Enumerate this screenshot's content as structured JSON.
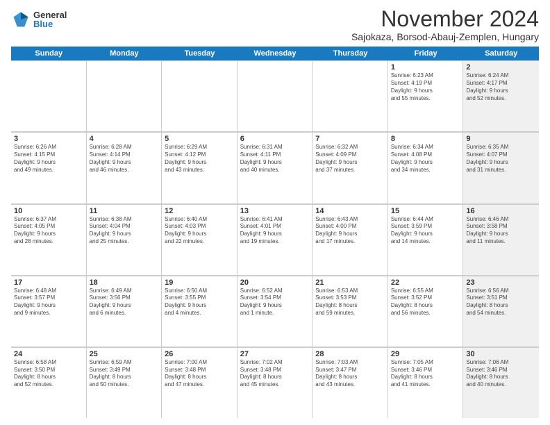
{
  "logo": {
    "general": "General",
    "blue": "Blue"
  },
  "title": "November 2024",
  "subtitle": "Sajokaza, Borsod-Abauj-Zemplen, Hungary",
  "header_days": [
    "Sunday",
    "Monday",
    "Tuesday",
    "Wednesday",
    "Thursday",
    "Friday",
    "Saturday"
  ],
  "rows": [
    [
      {
        "day": "",
        "info": "",
        "shaded": false,
        "empty": true
      },
      {
        "day": "",
        "info": "",
        "shaded": false,
        "empty": true
      },
      {
        "day": "",
        "info": "",
        "shaded": false,
        "empty": true
      },
      {
        "day": "",
        "info": "",
        "shaded": false,
        "empty": true
      },
      {
        "day": "",
        "info": "",
        "shaded": false,
        "empty": true
      },
      {
        "day": "1",
        "info": "Sunrise: 6:23 AM\nSunset: 4:19 PM\nDaylight: 9 hours\nand 55 minutes.",
        "shaded": false
      },
      {
        "day": "2",
        "info": "Sunrise: 6:24 AM\nSunset: 4:17 PM\nDaylight: 9 hours\nand 52 minutes.",
        "shaded": true
      }
    ],
    [
      {
        "day": "3",
        "info": "Sunrise: 6:26 AM\nSunset: 4:15 PM\nDaylight: 9 hours\nand 49 minutes.",
        "shaded": false
      },
      {
        "day": "4",
        "info": "Sunrise: 6:28 AM\nSunset: 4:14 PM\nDaylight: 9 hours\nand 46 minutes.",
        "shaded": false
      },
      {
        "day": "5",
        "info": "Sunrise: 6:29 AM\nSunset: 4:12 PM\nDaylight: 9 hours\nand 43 minutes.",
        "shaded": false
      },
      {
        "day": "6",
        "info": "Sunrise: 6:31 AM\nSunset: 4:11 PM\nDaylight: 9 hours\nand 40 minutes.",
        "shaded": false
      },
      {
        "day": "7",
        "info": "Sunrise: 6:32 AM\nSunset: 4:09 PM\nDaylight: 9 hours\nand 37 minutes.",
        "shaded": false
      },
      {
        "day": "8",
        "info": "Sunrise: 6:34 AM\nSunset: 4:08 PM\nDaylight: 9 hours\nand 34 minutes.",
        "shaded": false
      },
      {
        "day": "9",
        "info": "Sunrise: 6:35 AM\nSunset: 4:07 PM\nDaylight: 9 hours\nand 31 minutes.",
        "shaded": true
      }
    ],
    [
      {
        "day": "10",
        "info": "Sunrise: 6:37 AM\nSunset: 4:05 PM\nDaylight: 9 hours\nand 28 minutes.",
        "shaded": false
      },
      {
        "day": "11",
        "info": "Sunrise: 6:38 AM\nSunset: 4:04 PM\nDaylight: 9 hours\nand 25 minutes.",
        "shaded": false
      },
      {
        "day": "12",
        "info": "Sunrise: 6:40 AM\nSunset: 4:03 PM\nDaylight: 9 hours\nand 22 minutes.",
        "shaded": false
      },
      {
        "day": "13",
        "info": "Sunrise: 6:41 AM\nSunset: 4:01 PM\nDaylight: 9 hours\nand 19 minutes.",
        "shaded": false
      },
      {
        "day": "14",
        "info": "Sunrise: 6:43 AM\nSunset: 4:00 PM\nDaylight: 9 hours\nand 17 minutes.",
        "shaded": false
      },
      {
        "day": "15",
        "info": "Sunrise: 6:44 AM\nSunset: 3:59 PM\nDaylight: 9 hours\nand 14 minutes.",
        "shaded": false
      },
      {
        "day": "16",
        "info": "Sunrise: 6:46 AM\nSunset: 3:58 PM\nDaylight: 9 hours\nand 11 minutes.",
        "shaded": true
      }
    ],
    [
      {
        "day": "17",
        "info": "Sunrise: 6:48 AM\nSunset: 3:57 PM\nDaylight: 9 hours\nand 9 minutes.",
        "shaded": false
      },
      {
        "day": "18",
        "info": "Sunrise: 6:49 AM\nSunset: 3:56 PM\nDaylight: 9 hours\nand 6 minutes.",
        "shaded": false
      },
      {
        "day": "19",
        "info": "Sunrise: 6:50 AM\nSunset: 3:55 PM\nDaylight: 9 hours\nand 4 minutes.",
        "shaded": false
      },
      {
        "day": "20",
        "info": "Sunrise: 6:52 AM\nSunset: 3:54 PM\nDaylight: 9 hours\nand 1 minute.",
        "shaded": false
      },
      {
        "day": "21",
        "info": "Sunrise: 6:53 AM\nSunset: 3:53 PM\nDaylight: 8 hours\nand 59 minutes.",
        "shaded": false
      },
      {
        "day": "22",
        "info": "Sunrise: 6:55 AM\nSunset: 3:52 PM\nDaylight: 8 hours\nand 56 minutes.",
        "shaded": false
      },
      {
        "day": "23",
        "info": "Sunrise: 6:56 AM\nSunset: 3:51 PM\nDaylight: 8 hours\nand 54 minutes.",
        "shaded": true
      }
    ],
    [
      {
        "day": "24",
        "info": "Sunrise: 6:58 AM\nSunset: 3:50 PM\nDaylight: 8 hours\nand 52 minutes.",
        "shaded": false
      },
      {
        "day": "25",
        "info": "Sunrise: 6:59 AM\nSunset: 3:49 PM\nDaylight: 8 hours\nand 50 minutes.",
        "shaded": false
      },
      {
        "day": "26",
        "info": "Sunrise: 7:00 AM\nSunset: 3:48 PM\nDaylight: 8 hours\nand 47 minutes.",
        "shaded": false
      },
      {
        "day": "27",
        "info": "Sunrise: 7:02 AM\nSunset: 3:48 PM\nDaylight: 8 hours\nand 45 minutes.",
        "shaded": false
      },
      {
        "day": "28",
        "info": "Sunrise: 7:03 AM\nSunset: 3:47 PM\nDaylight: 8 hours\nand 43 minutes.",
        "shaded": false
      },
      {
        "day": "29",
        "info": "Sunrise: 7:05 AM\nSunset: 3:46 PM\nDaylight: 8 hours\nand 41 minutes.",
        "shaded": false
      },
      {
        "day": "30",
        "info": "Sunrise: 7:06 AM\nSunset: 3:46 PM\nDaylight: 8 hours\nand 40 minutes.",
        "shaded": true
      }
    ]
  ]
}
